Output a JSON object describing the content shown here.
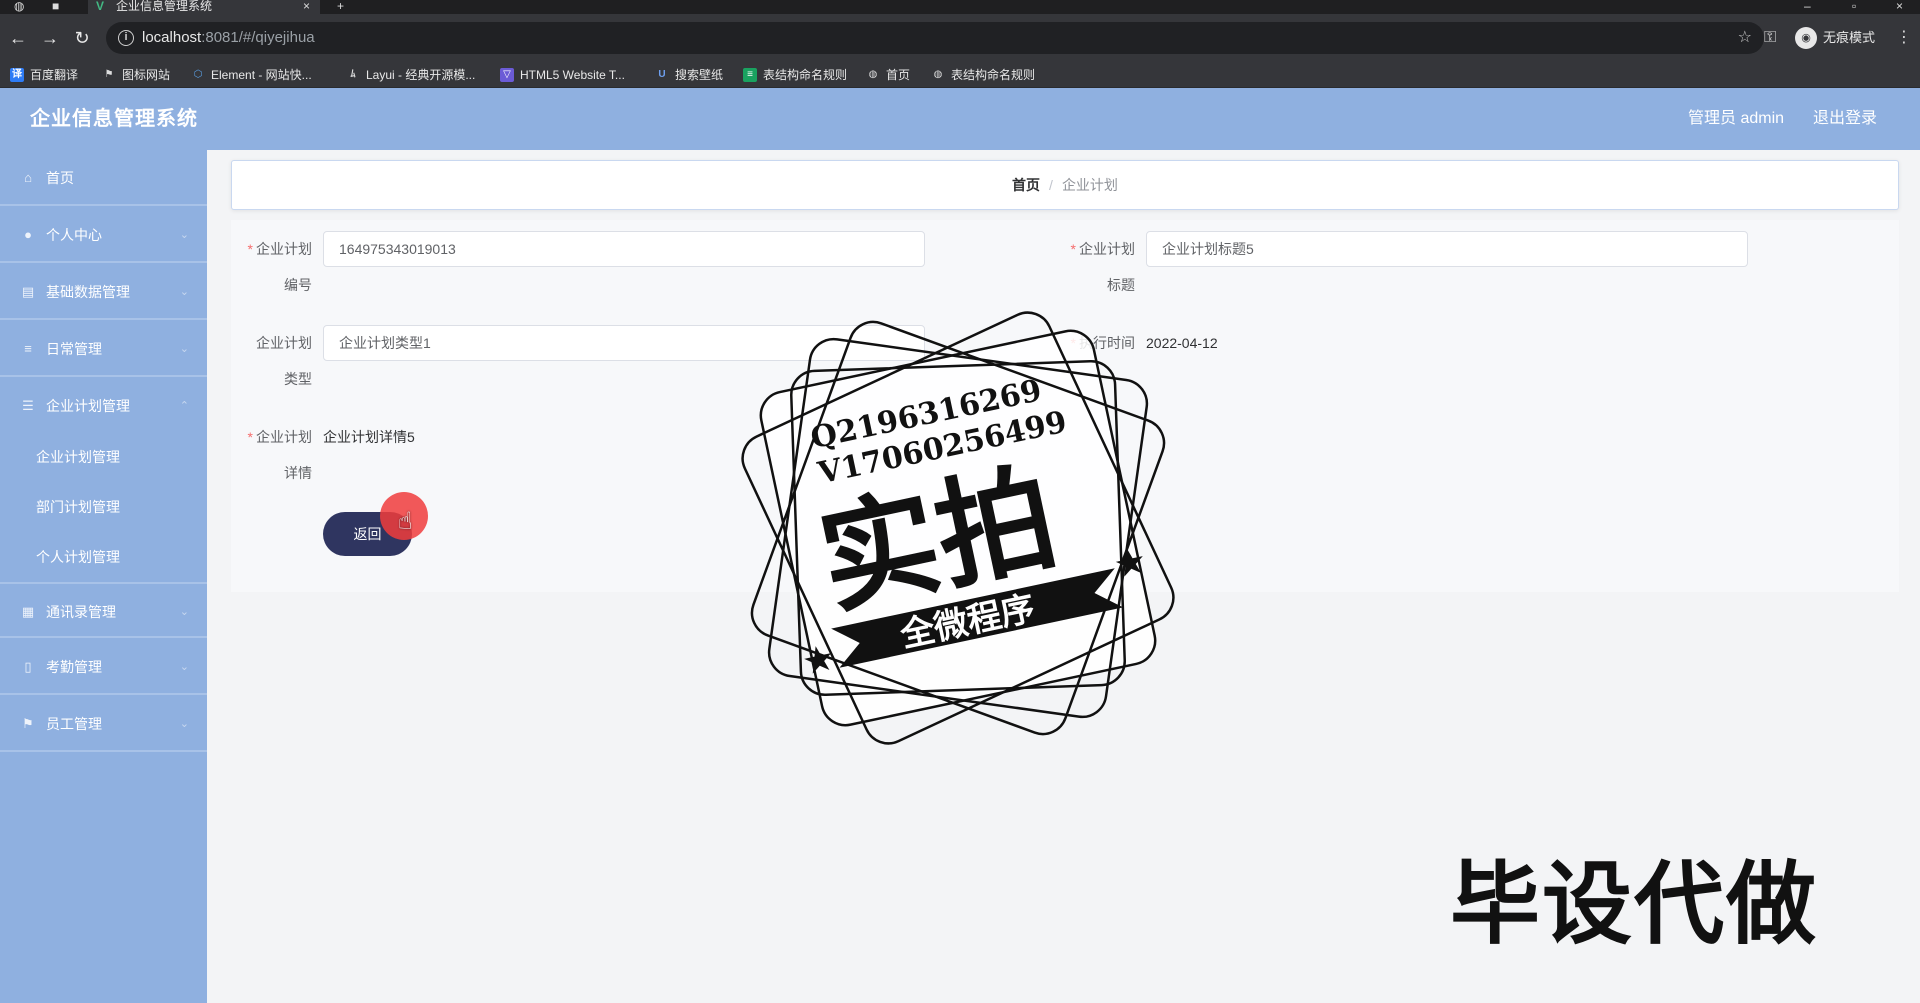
{
  "browser": {
    "tab_title": "企业信息管理系统",
    "tab_close": "×",
    "new_tab": "+",
    "url_host": "localhost",
    "url_path": ":8081/#/qiyejihua",
    "incognito_label": "无痕模式",
    "bookmarks": [
      {
        "label": "百度翻译",
        "icon_color": "#2e7cf6"
      },
      {
        "label": "图标网站",
        "icon_color": "#444444"
      },
      {
        "label": "Element - 网站快...",
        "icon_color": "#3b82c4"
      },
      {
        "label": "Layui - 经典开源模...",
        "icon_color": "#555555"
      },
      {
        "label": "HTML5 Website T...",
        "icon_color": "#6b5bd6"
      },
      {
        "label": "搜索壁纸",
        "icon_color": "#3a6fd8"
      },
      {
        "label": "表结构命名规则",
        "icon_color": "#1aa260"
      },
      {
        "label": "首页",
        "icon_color": "#666666"
      },
      {
        "label": "表结构命名规则",
        "icon_color": "#666666"
      }
    ]
  },
  "header": {
    "title": "企业信息管理系统",
    "admin": "管理员 admin",
    "logout": "退出登录"
  },
  "sidebar": {
    "items": [
      {
        "label": "首页",
        "icon": "home-icon",
        "glyph": "⌂"
      },
      {
        "label": "个人中心",
        "icon": "user-icon",
        "glyph": "●"
      },
      {
        "label": "基础数据管理",
        "icon": "clipboard-icon",
        "glyph": "▤"
      },
      {
        "label": "日常管理",
        "icon": "list-icon",
        "glyph": "≡"
      },
      {
        "label": "企业计划管理",
        "icon": "stack-icon",
        "glyph": "☰"
      }
    ],
    "sub_items": [
      "企业计划管理",
      "部门计划管理",
      "个人计划管理"
    ],
    "more_items": [
      {
        "label": "通讯录管理",
        "icon": "grid-icon",
        "glyph": "▦"
      },
      {
        "label": "考勤管理",
        "icon": "doc-icon",
        "glyph": "▯"
      },
      {
        "label": "员工管理",
        "icon": "flag-icon",
        "glyph": "⚑"
      }
    ]
  },
  "breadcrumb": {
    "home": "首页",
    "separator": "/",
    "current": "企业计划"
  },
  "form": {
    "plan_no": {
      "label_line1": "企业计划",
      "label_line2": "编号",
      "value": "164975343019013"
    },
    "plan_title": {
      "label_line1": "企业计划",
      "label_line2": "标题",
      "value": "企业计划标题5"
    },
    "plan_type": {
      "label_line1": "企业计划",
      "label_line2": "类型",
      "value": "企业计划类型1"
    },
    "exec_time": {
      "label": "执行时间",
      "value": "2022-04-12"
    },
    "plan_detail": {
      "label_line1": "企业计划",
      "label_line2": "详情",
      "value": "企业计划详情5"
    },
    "required_mark": "*",
    "back_button": "返回"
  },
  "watermark": {
    "line1": "Q2196316269",
    "line2": "V17060256499",
    "big": "实拍",
    "ribbon": "全微程序",
    "bottom": "毕设代做"
  }
}
